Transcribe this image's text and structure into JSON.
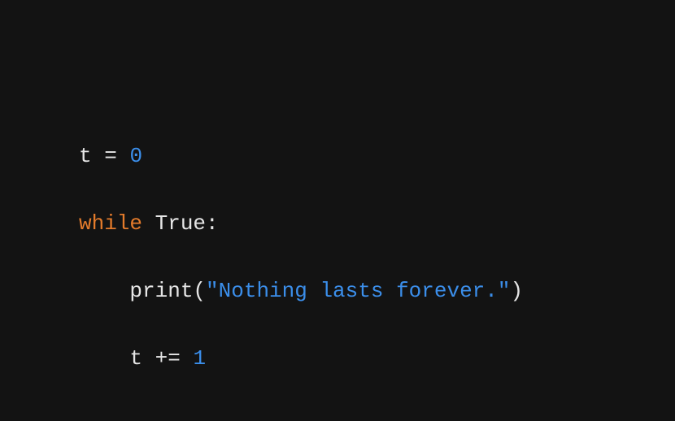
{
  "code": {
    "line1": {
      "var": "t",
      "op": "=",
      "num": "0"
    },
    "line2": {
      "keyword": "while",
      "bool": "True",
      "colon": ":"
    },
    "line3": {
      "func": "print",
      "lparen": "(",
      "string": "\"Nothing lasts forever.\"",
      "rparen": ")"
    },
    "line4": {
      "var": "t",
      "op": "+=",
      "num": "1"
    }
  }
}
